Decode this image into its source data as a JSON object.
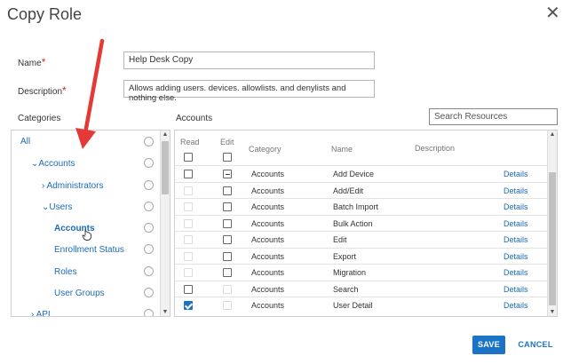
{
  "dialog": {
    "title": "Copy Role"
  },
  "form": {
    "name_label": "Name",
    "name_value": "Help Desk Copy",
    "description_label": "Description",
    "description_value": "Allows adding users. devices. allowlists. and denylists and nothing else.",
    "required_mark": "*"
  },
  "categories": {
    "label": "Categories",
    "items": [
      {
        "label": "All"
      },
      {
        "label": "Accounts",
        "chevron": "⌄"
      },
      {
        "label": "Administrators",
        "chevron": "›"
      },
      {
        "label": "Users",
        "chevron": "⌄"
      },
      {
        "label": "Accounts"
      },
      {
        "label": "Enrollment Status"
      },
      {
        "label": "Roles"
      },
      {
        "label": "User Groups"
      },
      {
        "label": "API",
        "chevron": "›"
      }
    ]
  },
  "resources": {
    "label": "Accounts",
    "search_placeholder": "Search Resources",
    "columns": {
      "read": "Read",
      "edit": "Edit",
      "category": "Category",
      "name": "Name",
      "description": "Description"
    },
    "rows": [
      {
        "category": "Accounts",
        "name": "Add Device",
        "details": "Details",
        "read": "empty",
        "edit": "indeterminate"
      },
      {
        "category": "Accounts",
        "name": "Add/Edit",
        "details": "Details",
        "read": "disabled",
        "edit": "empty"
      },
      {
        "category": "Accounts",
        "name": "Batch Import",
        "details": "Details",
        "read": "disabled",
        "edit": "empty"
      },
      {
        "category": "Accounts",
        "name": "Bulk Action",
        "details": "Details",
        "read": "disabled",
        "edit": "empty"
      },
      {
        "category": "Accounts",
        "name": "Edit",
        "details": "Details",
        "read": "disabled",
        "edit": "empty"
      },
      {
        "category": "Accounts",
        "name": "Export",
        "details": "Details",
        "read": "disabled",
        "edit": "empty"
      },
      {
        "category": "Accounts",
        "name": "Migration",
        "details": "Details",
        "read": "disabled",
        "edit": "empty"
      },
      {
        "category": "Accounts",
        "name": "Search",
        "details": "Details",
        "read": "empty",
        "edit": "disabled"
      },
      {
        "category": "Accounts",
        "name": "User Detail",
        "details": "Details",
        "read": "checked",
        "edit": "disabled"
      }
    ]
  },
  "footer": {
    "save_label": "SAVE",
    "cancel_label": "CANCEL"
  },
  "colors": {
    "accent": "#1a73c7",
    "required": "#d32f2f",
    "annotation_arrow": "#e53935"
  }
}
